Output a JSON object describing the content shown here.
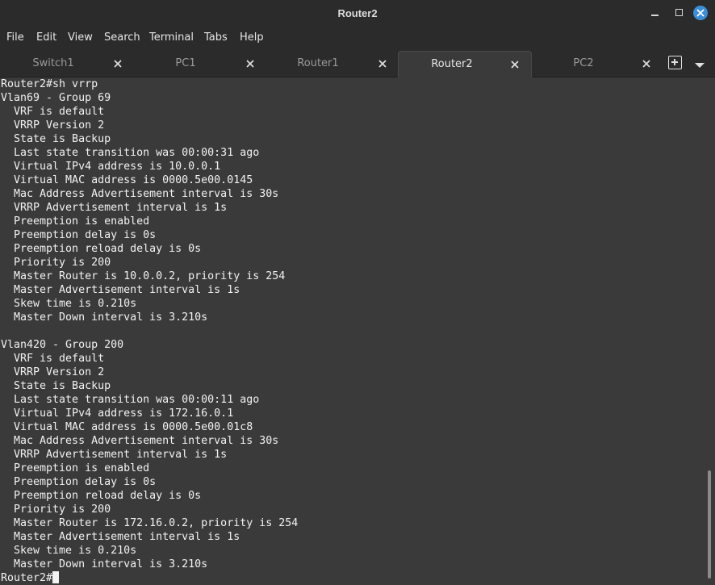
{
  "window": {
    "title": "Router2"
  },
  "menu": [
    "File",
    "Edit",
    "View",
    "Search",
    "Terminal",
    "Tabs",
    "Help"
  ],
  "tabs": [
    {
      "label": "Switch1",
      "active": false
    },
    {
      "label": "PC1",
      "active": false
    },
    {
      "label": "Router1",
      "active": false
    },
    {
      "label": "Router2",
      "active": true
    },
    {
      "label": "PC2",
      "active": false
    }
  ],
  "icons": {
    "minimize": "minimize-icon",
    "maximize": "maximize-icon",
    "close": "close-icon",
    "tab_close": "close-icon",
    "new_tab": "plus-box-icon",
    "tab_menu": "chevron-down-icon"
  },
  "colors": {
    "accent": "#3d8ed8",
    "terminal_bg": "#3a3a3a",
    "terminal_fg": "#f2f2f2"
  },
  "terminal": {
    "lines": [
      "Router2#sh vrrp",
      "Vlan69 - Group 69",
      "  VRF is default",
      "  VRRP Version 2",
      "  State is Backup",
      "  Last state transition was 00:00:31 ago",
      "  Virtual IPv4 address is 10.0.0.1",
      "  Virtual MAC address is 0000.5e00.0145",
      "  Mac Address Advertisement interval is 30s",
      "  VRRP Advertisement interval is 1s",
      "  Preemption is enabled",
      "  Preemption delay is 0s",
      "  Preemption reload delay is 0s",
      "  Priority is 200",
      "  Master Router is 10.0.0.2, priority is 254",
      "  Master Advertisement interval is 1s",
      "  Skew time is 0.210s",
      "  Master Down interval is 3.210s",
      "",
      "Vlan420 - Group 200",
      "  VRF is default",
      "  VRRP Version 2",
      "  State is Backup",
      "  Last state transition was 00:00:11 ago",
      "  Virtual IPv4 address is 172.16.0.1",
      "  Virtual MAC address is 0000.5e00.01c8",
      "  Mac Address Advertisement interval is 30s",
      "  VRRP Advertisement interval is 1s",
      "  Preemption is enabled",
      "  Preemption delay is 0s",
      "  Preemption reload delay is 0s",
      "  Priority is 200",
      "  Master Router is 172.16.0.2, priority is 254",
      "  Master Advertisement interval is 1s",
      "  Skew time is 0.210s",
      "  Master Down interval is 3.210s"
    ],
    "prompt": "Router2#"
  }
}
